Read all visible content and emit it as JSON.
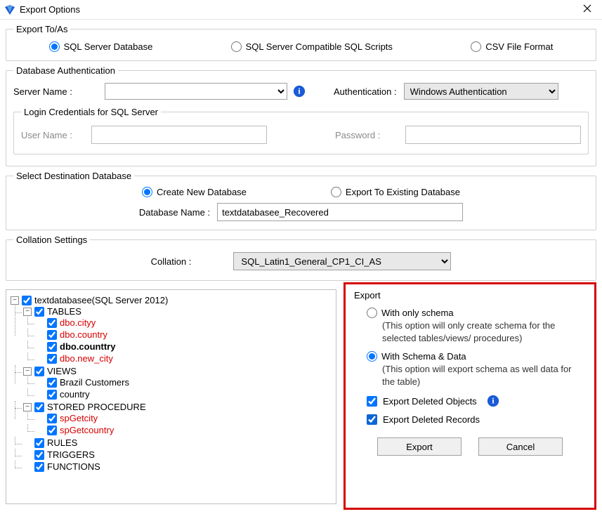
{
  "window": {
    "title": "Export Options"
  },
  "exportTo": {
    "legend": "Export To/As",
    "options": {
      "sqlServer": "SQL Server Database",
      "scripts": "SQL Server Compatible SQL Scripts",
      "csv": "CSV File Format"
    }
  },
  "auth": {
    "legend": "Database Authentication",
    "serverNameLabel": "Server Name :",
    "serverNameValue": "",
    "authenticationLabel": "Authentication :",
    "authenticationValue": "Windows Authentication",
    "login": {
      "legend": "Login Credentials for SQL Server",
      "userNameLabel": "User Name :",
      "userNameValue": "",
      "passwordLabel": "Password :",
      "passwordValue": ""
    }
  },
  "destination": {
    "legend": "Select Destination Database",
    "createNew": "Create New Database",
    "existing": "Export To Existing Database",
    "dbNameLabel": "Database Name :",
    "dbNameValue": "textdatabasee_Recovered"
  },
  "collation": {
    "legend": "Collation Settings",
    "label": "Collation :",
    "value": "SQL_Latin1_General_CP1_CI_AS"
  },
  "tree": {
    "root": "textdatabasee(SQL Server 2012)",
    "tablesLabel": "TABLES",
    "tables": [
      "dbo.cityy",
      "dbo.country",
      "dbo.counttry",
      "dbo.new_city"
    ],
    "viewsLabel": "VIEWS",
    "views": [
      "Brazil Customers",
      "country"
    ],
    "spLabel": "STORED PROCEDURE",
    "sps": [
      "spGetcity",
      "spGetcountry"
    ],
    "rulesLabel": "RULES",
    "triggersLabel": "TRIGGERS",
    "functionsLabel": "FUNCTIONS"
  },
  "exportPanel": {
    "title": "Export",
    "schemaOnly": "With only schema",
    "schemaOnlyDesc": "(This option will only create schema for the  selected tables/views/ procedures)",
    "schemaData": "With Schema & Data",
    "schemaDataDesc": "(This option will export schema as well data for the table)",
    "deletedObjects": "Export Deleted Objects",
    "deletedRecords": "Export Deleted Records",
    "exportBtn": "Export",
    "cancelBtn": "Cancel"
  }
}
